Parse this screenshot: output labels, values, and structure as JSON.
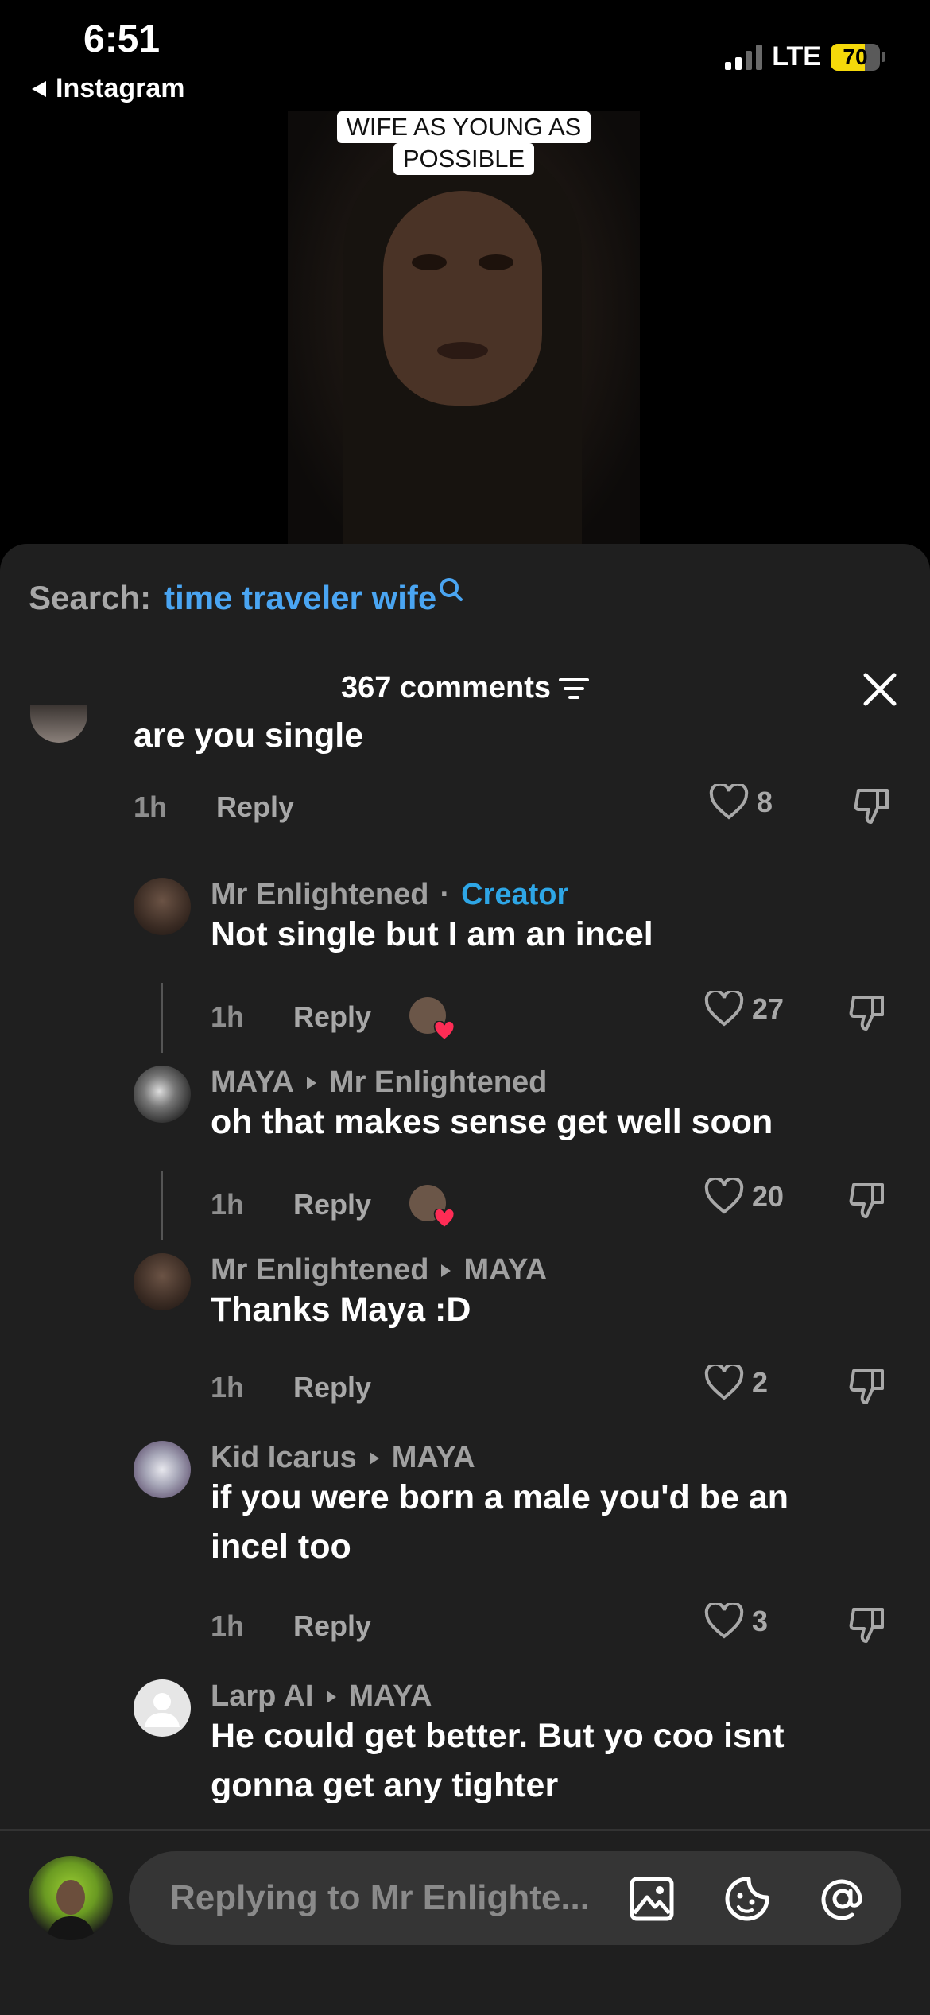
{
  "status_bar": {
    "time": "6:51",
    "back_label": "Instagram",
    "network": "LTE",
    "battery": "70",
    "battery_level": 0.7
  },
  "video": {
    "caption_line1": "WIFE AS YOUNG AS",
    "caption_line2": "POSSIBLE"
  },
  "search": {
    "label": "Search:",
    "term": "time traveler wife"
  },
  "comments_header": {
    "count_label": "367 comments"
  },
  "comments": [
    {
      "text": "are you single",
      "time": "1h",
      "reply": "Reply",
      "likes": "8"
    },
    {
      "author": "Mr Enlightened",
      "separator": "·",
      "badge": "Creator",
      "text": "Not single but I am an incel",
      "time": "1h",
      "reply": "Reply",
      "likes": "27"
    },
    {
      "author": "MAYA",
      "reply_to": "Mr Enlightened",
      "text": "oh that makes sense get well soon",
      "time": "1h",
      "reply": "Reply",
      "likes": "20"
    },
    {
      "author": "Mr Enlightened",
      "reply_to": "MAYA",
      "text": "Thanks Maya :D",
      "time": "1h",
      "reply": "Reply",
      "likes": "2"
    },
    {
      "author": "Kid Icarus",
      "reply_to": "MAYA",
      "text_line1": "if you were born a male you'd be an",
      "text_line2": "incel too",
      "time": "1h",
      "reply": "Reply",
      "likes": "3"
    },
    {
      "author": "Larp AI",
      "reply_to": "MAYA",
      "text_line1": "He could get better. But yo coo isnt",
      "text_line2": "gonna get any tighter"
    }
  ],
  "input": {
    "placeholder": "Replying to Mr Enlighte..."
  },
  "colors": {
    "accent_blue": "#4aa5f2",
    "creator_blue": "#2ea6e6",
    "heart_red": "#fe2c55",
    "battery_yellow": "#f5d90a"
  }
}
